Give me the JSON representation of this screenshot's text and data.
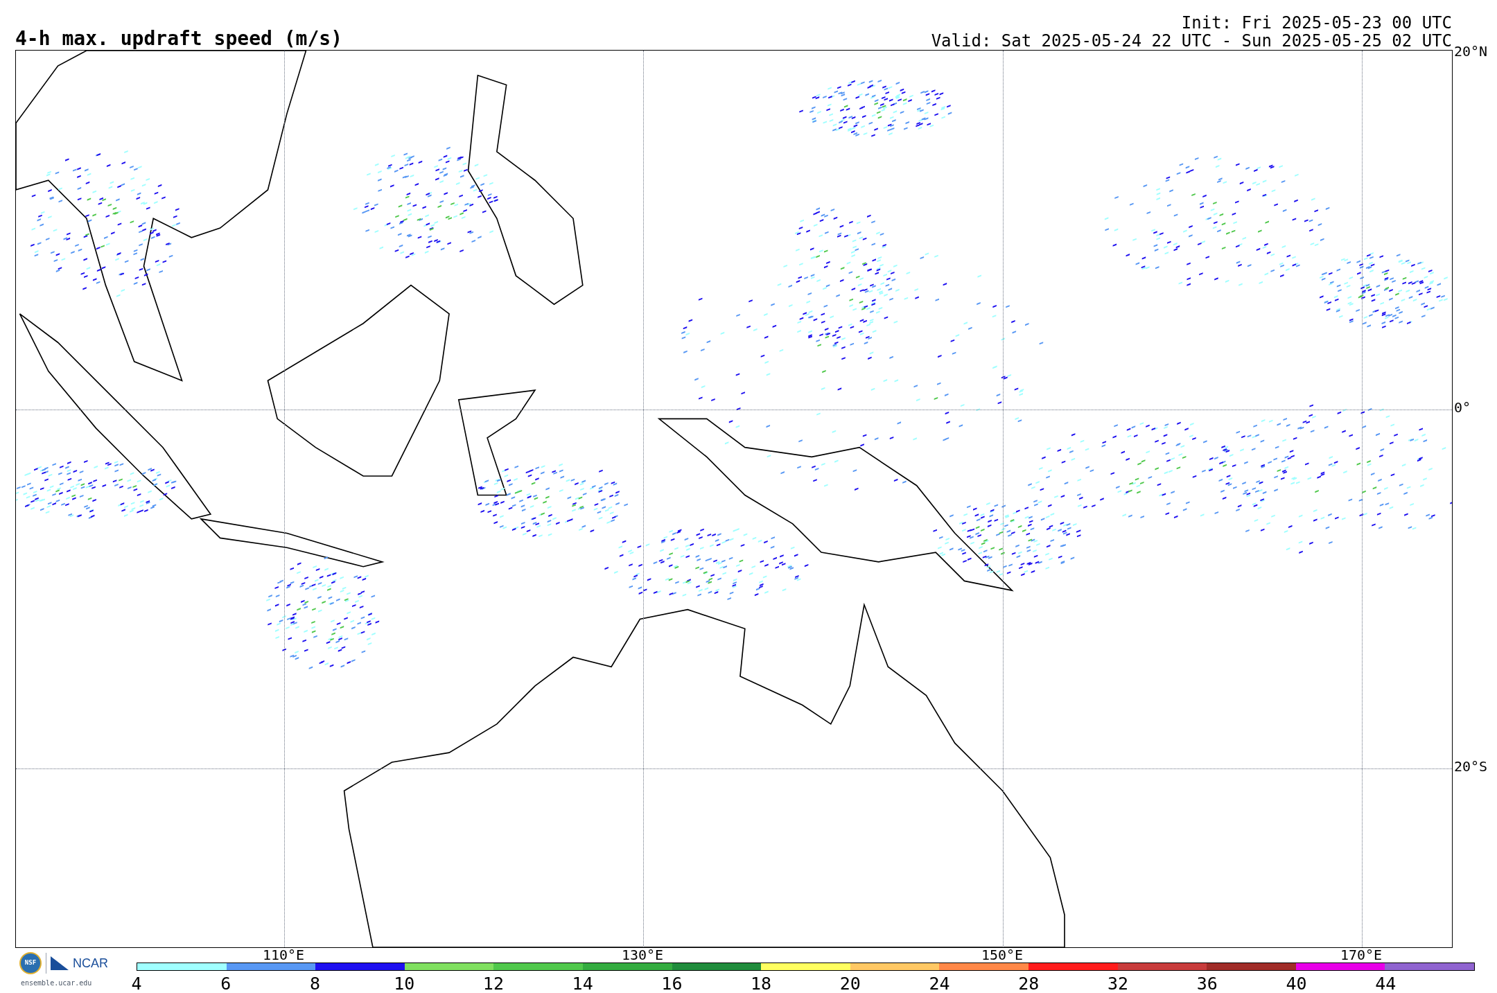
{
  "title": "4-h max. updraft speed (m/s)",
  "init": "Init: Fri 2025-05-23 00 UTC",
  "valid": "Valid: Sat 2025-05-24 22 UTC - Sun 2025-05-25 02 UTC",
  "map": {
    "lat_labels": [
      "20°N",
      "0°",
      "20°S"
    ],
    "lon_labels": [
      "110°E",
      "130°E",
      "150°E",
      "170°E"
    ]
  },
  "colorbar": [
    {
      "label": "4",
      "color": "#a0ffff"
    },
    {
      "label": "6",
      "color": "#5898f4"
    },
    {
      "label": "8",
      "color": "#1e10f0"
    },
    {
      "label": "10",
      "color": "#80e060"
    },
    {
      "label": "12",
      "color": "#50c84c"
    },
    {
      "label": "14",
      "color": "#34ac40"
    },
    {
      "label": "16",
      "color": "#208c3c"
    },
    {
      "label": "18",
      "color": "#ffff60"
    },
    {
      "label": "20",
      "color": "#ffc864"
    },
    {
      "label": "24",
      "color": "#ff8848"
    },
    {
      "label": "28",
      "color": "#ff1c1c"
    },
    {
      "label": "32",
      "color": "#c83c3c"
    },
    {
      "label": "36",
      "color": "#a02c28"
    },
    {
      "label": "40",
      "color": "#e800e8"
    },
    {
      "label": "44",
      "color": "#9064d0"
    }
  ],
  "logos": {
    "nsf": "NSF",
    "ncar": "NCAR",
    "url": "ensemble.ucar.edu"
  }
}
